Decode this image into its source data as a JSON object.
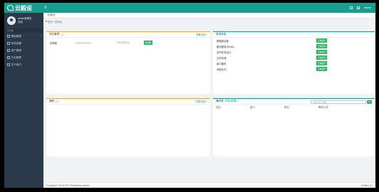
{
  "app": {
    "logo_text": "云毅设"
  },
  "topbar": {
    "menu_icon": "≡",
    "user_label": "admin",
    "icons": [
      "window-icon",
      "lock-icon"
    ]
  },
  "sidebar": {
    "user_name": "admin管理员",
    "user_status": "在线",
    "section_label": "主导航",
    "items": [
      {
        "label": "基础管理"
      },
      {
        "label": "系统设置"
      },
      {
        "label": "用户管理"
      },
      {
        "label": "日志管理"
      },
      {
        "label": "关于我们"
      }
    ]
  },
  "tabs": [
    {
      "label": "控制台"
    }
  ],
  "breadcrumb": {
    "home": "首页",
    "sep": "/",
    "current": "控制台"
  },
  "panel_left_top": {
    "title": "待办事项",
    "count": "(1)",
    "more": "查看全部 »",
    "row_label": "待审核",
    "row_meta": "2022-05-12",
    "row_button": "去处理"
  },
  "panel_right_top": {
    "title": "系统状态",
    "rows": [
      {
        "label": "数据库连接",
        "status": "正常运行"
      },
      {
        "label": "缓存服务(Redis)",
        "status": "正常运行"
      },
      {
        "label": "定时任务运行",
        "status": "正常运行"
      },
      {
        "label": "文件存储",
        "status": "正常运行"
      },
      {
        "label": "接口服务",
        "status": "正常运行"
      },
      {
        "label": "消息队列",
        "status": "正常运行"
      }
    ]
  },
  "panel_left_bottom": {
    "title": "通知",
    "count": "(0)",
    "more": "查看全部 »"
  },
  "panel_right_bottom": {
    "title": "通讯录",
    "subtitle": "(同步数据)",
    "search_placeholder": "姓名/部门/电话",
    "search_button": "Q",
    "columns": [
      "姓名",
      "部门",
      "职位",
      "联系方式"
    ]
  },
  "footer": {
    "copyright": "Copyright © 2016-2022 Powered by admin",
    "version": "Version 1.0"
  }
}
